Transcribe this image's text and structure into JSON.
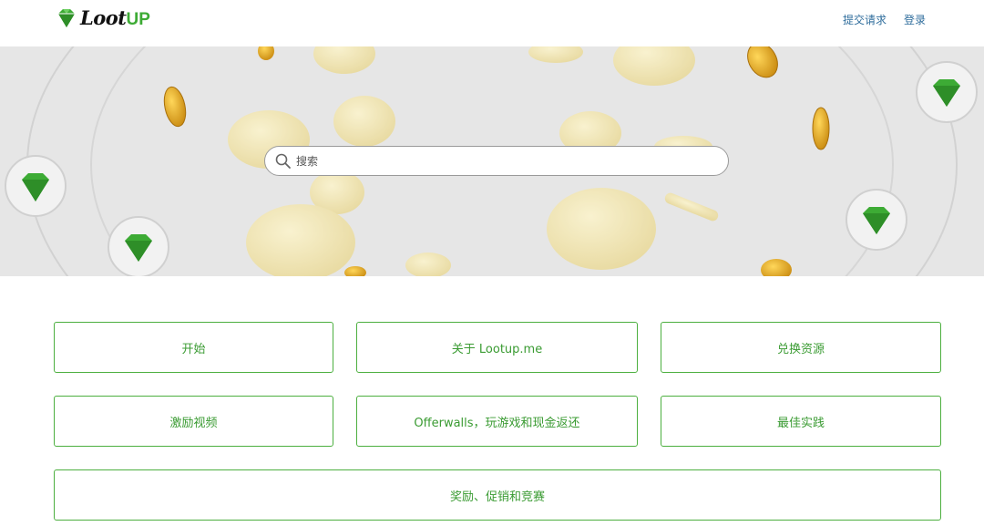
{
  "brand": {
    "name": "Loot",
    "name_accent": "UP"
  },
  "nav": {
    "submit_label": "提交请求",
    "login_label": "登录"
  },
  "search": {
    "placeholder": "搜索",
    "value": ""
  },
  "categories": [
    {
      "label": "开始"
    },
    {
      "label": "关于 Lootup.me"
    },
    {
      "label": "兑换资源"
    },
    {
      "label": "激励视频"
    },
    {
      "label": "Offerwalls，玩游戏和现金返还"
    },
    {
      "label": "最佳实践"
    },
    {
      "label": "奖励、促销和竞赛"
    }
  ],
  "colors": {
    "accent_green": "#3dab35",
    "link_blue": "#2f6d9c",
    "hero_bg": "#e6e6e6",
    "coin_gold": "#e3a41c"
  }
}
